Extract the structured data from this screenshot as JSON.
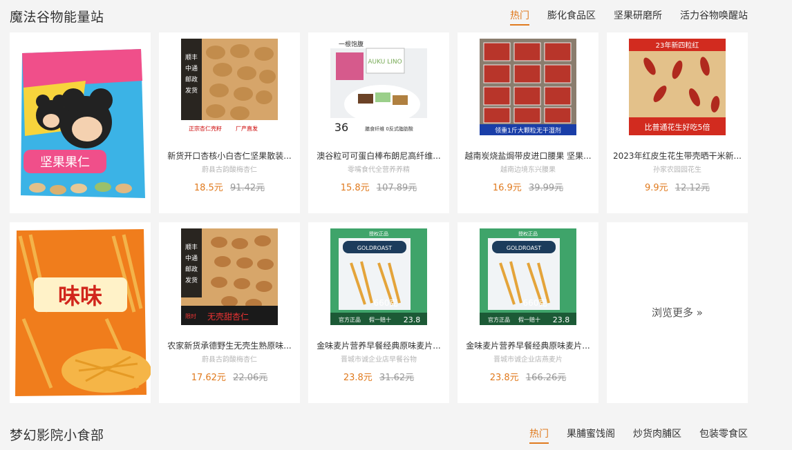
{
  "section1": {
    "title": "魔法谷物能量站",
    "tabs": [
      "热门",
      "膨化食品区",
      "坚果研磨所",
      "活力谷物唤醒站"
    ]
  },
  "row1": {
    "banner_text": "坚果果仁",
    "products": [
      {
        "name": "新货开口杏核小白杏仁坚果散装...",
        "shop": "蔚县古韵酸梅杏仁",
        "price": "18.5元",
        "orig": "91.42元",
        "thumb_text": [
          "顺丰",
          "中通",
          "邮政",
          "发货",
          "正宗杏仁壳籽",
          "厂产直发"
        ]
      },
      {
        "name": "澳谷粒可可蛋白棒布朗尼高纤维...",
        "shop": "零嘴食代全营养养精",
        "price": "15.8元",
        "orig": "107.89元",
        "thumb_text": [
          "一根饱腹",
          "AUKU LINO",
          "36",
          "膳食纤维 0反式脂肪酸"
        ]
      },
      {
        "name": "越南炭烧盐焗带皮进口腰果 坚果...",
        "shop": "越南边境东兴腰果",
        "price": "16.9元",
        "orig": "39.99元",
        "thumb_text": [
          "领重1斤大颗粒无干湿剂"
        ]
      },
      {
        "name": "2023年红皮生花生带壳晒干米新...",
        "shop": "孙家农园园花生",
        "price": "9.9元",
        "orig": "12.12元",
        "thumb_text": [
          "23年新四粒红",
          "比普通花生好吃5倍"
        ]
      }
    ]
  },
  "row2": {
    "banner_text": "味味",
    "products": [
      {
        "name": "农家新货承德野生无壳生熟原味...",
        "shop": "蔚县古韵酸梅杏仁",
        "price": "17.62元",
        "orig": "22.06元",
        "thumb_text": [
          "顺丰",
          "中通",
          "邮政",
          "发货",
          "无壳甜杏仁",
          "限时"
        ]
      },
      {
        "name": "金味麦片营养早餐经典原味麦片...",
        "shop": "晋城市诚企业店早餐谷物",
        "price": "23.8元",
        "orig": "31.62元",
        "thumb_text": [
          "授权正品",
          "GOLDROAST",
          "660克",
          "官方正品",
          "假一赔十",
          "23.8"
        ]
      },
      {
        "name": "金味麦片营养早餐经典原味麦片...",
        "shop": "晋城市诚企业店燕麦片",
        "price": "23.8元",
        "orig": "166.26元",
        "thumb_text": [
          "授权正品",
          "GOLDROAST",
          "660克",
          "官方正品",
          "假一赔十",
          "23.8"
        ]
      }
    ],
    "more_label": "浏览更多 »"
  },
  "section2": {
    "title": "梦幻影院小食部",
    "tabs": [
      "热门",
      "果脯蜜饯阁",
      "炒货肉脯区",
      "包装零食区"
    ]
  }
}
